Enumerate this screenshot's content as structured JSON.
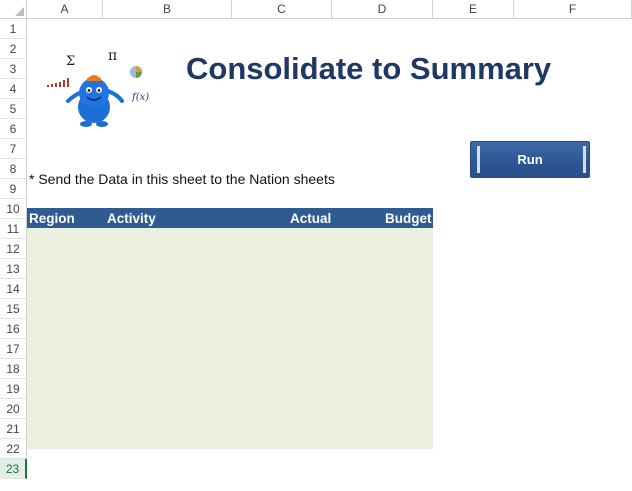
{
  "columns": [
    "A",
    "B",
    "C",
    "D",
    "E",
    "F"
  ],
  "rows": [
    "1",
    "2",
    "3",
    "4",
    "5",
    "6",
    "7",
    "8",
    "9",
    "10",
    "11",
    "12",
    "13",
    "14",
    "15",
    "16",
    "17",
    "18",
    "19",
    "20",
    "21",
    "22",
    "23"
  ],
  "selected_row": "23",
  "title": "Consolidate to Summary",
  "run_button": "Run",
  "note": "* Send the Data in this sheet to the Nation sheets",
  "table": {
    "headers": [
      "Region",
      "Activity",
      "Actual",
      "Budget"
    ],
    "header_color": "#2e5b92",
    "body_color": "#ebf1de"
  },
  "logo": {
    "sigma": "Σ",
    "pi": "π",
    "fx": "f(x)"
  },
  "colors": {
    "title": "#1f3864",
    "button": "#2e5692",
    "selected_row": "#217346"
  }
}
